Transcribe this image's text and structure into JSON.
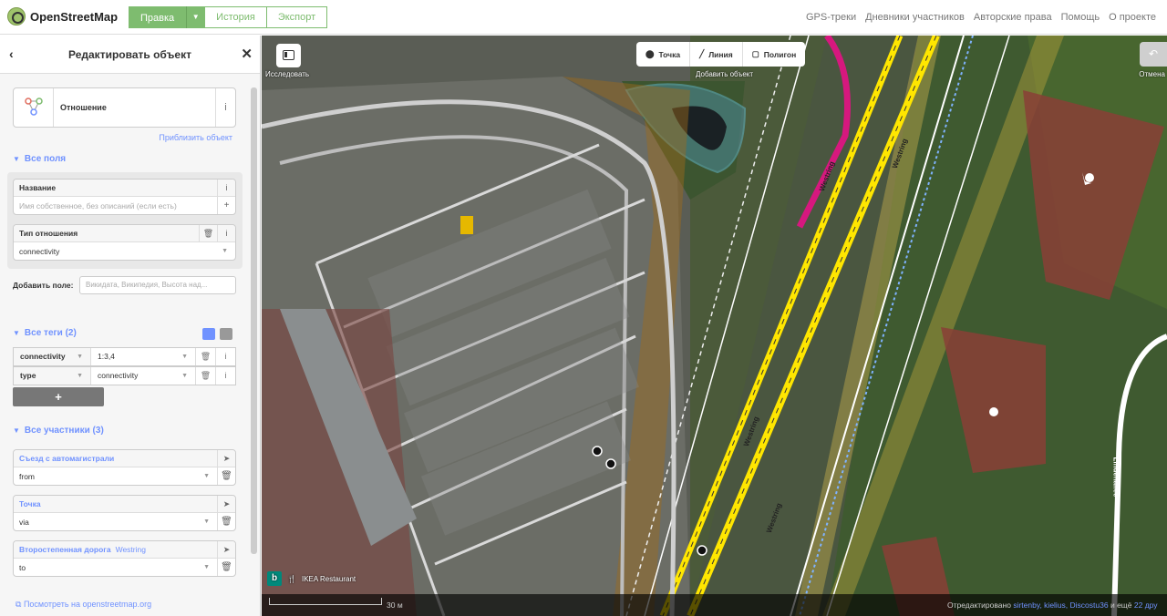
{
  "app": {
    "name": "OpenStreetMap"
  },
  "topbar": {
    "edit_label": "Правка",
    "history_label": "История",
    "export_label": "Экспорт",
    "links": [
      "GPS-треки",
      "Дневники участников",
      "Авторские права",
      "Помощь",
      "О проекте"
    ]
  },
  "sidebar": {
    "title": "Редактировать объект",
    "preset_label": "Отношение",
    "zoom_to": "Приблизить объект",
    "fields_section": "Все поля",
    "name_field": {
      "label": "Название",
      "placeholder": "Имя собственное, без описаний (если есть)"
    },
    "type_field": {
      "label": "Тип отношения",
      "value": "connectivity"
    },
    "add_field": {
      "label": "Добавить поле:",
      "placeholder": "Викидата, Википедия, Высота над..."
    },
    "tags_section": "Все теги (2)",
    "tags": [
      {
        "key": "connectivity",
        "value": "1:3,4"
      },
      {
        "key": "type",
        "value": "connectivity"
      }
    ],
    "add_tag_label": "+",
    "members_section": "Все участники (3)",
    "members": [
      {
        "label": "Съезд с автомагистрали",
        "sub": "",
        "role": "from"
      },
      {
        "label": "Точка",
        "sub": "",
        "role": "via"
      },
      {
        "label": "Второстепенная дорога",
        "sub": "Westring",
        "role": "to"
      }
    ],
    "osm_link": "Посмотреть на openstreetmap.org"
  },
  "map": {
    "explore_label": "Исследовать",
    "modes": [
      {
        "icon": "point-icon",
        "label": "Точка"
      },
      {
        "icon": "line-icon",
        "label": "Линия"
      },
      {
        "icon": "polygon-icon",
        "label": "Полигон"
      }
    ],
    "add_feature_label": "Добавить объект",
    "undo_label": "Отмена",
    "road_labels": {
      "westring": "Westring",
      "lindenallee": "Lindenallee"
    },
    "poi_label": "IKEA Restaurant",
    "scale": "30 м",
    "edited_prefix": "Отредактировано",
    "editors": "sirtenby, kielius, Discostu36",
    "edited_suffix": "и ещё",
    "more_count": "22 дру"
  }
}
